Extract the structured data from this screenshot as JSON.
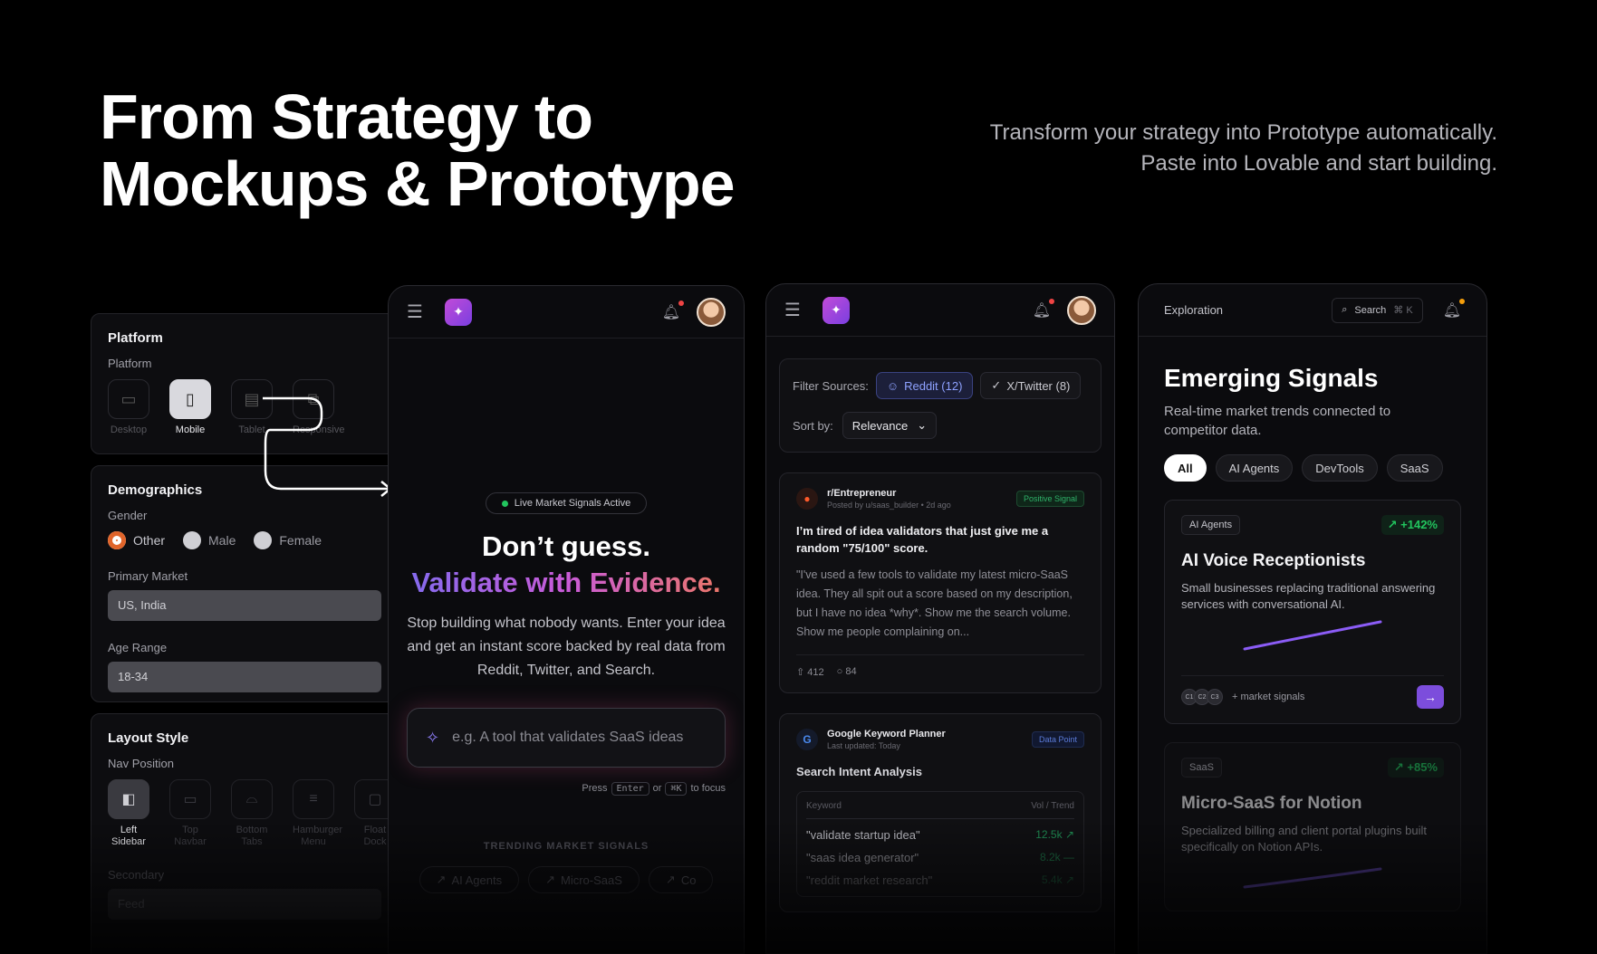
{
  "hero": {
    "title_line1": "From Strategy to",
    "title_line2": "Mockups & Prototype",
    "subtitle_line1": "Transform your strategy into Prototype automatically.",
    "subtitle_line2": "Paste into Lovable and start building."
  },
  "settings": {
    "platform": {
      "title": "Platform",
      "label": "Platform",
      "options": [
        "Desktop",
        "Mobile",
        "Tablet",
        "Responsive"
      ],
      "selected": "Mobile"
    },
    "demographics": {
      "title": "Demographics",
      "gender_label": "Gender",
      "genders": [
        "Other",
        "Male",
        "Female"
      ],
      "selected_gender": "Other",
      "market_label": "Primary Market",
      "market_value": "US, India",
      "age_label": "Age Range",
      "age_value": "18-34"
    },
    "layout": {
      "title": "Layout Style",
      "nav_label": "Nav Position",
      "options": [
        "Left Sidebar",
        "Top Navbar",
        "Bottom Tabs",
        "Hamburger Menu",
        "Float Dock"
      ],
      "selected": "Left Sidebar",
      "secondary_label": "Secondary",
      "secondary_value": "Feed"
    }
  },
  "phone1": {
    "live_label": "Live Market Signals Active",
    "headline1": "Don’t guess.",
    "headline2": "Validate with Evidence.",
    "body": "Stop building what nobody wants. Enter your idea and get an instant score backed by real data from Reddit, Twitter, and Search.",
    "input_placeholder": "e.g. A tool that validates SaaS ideas",
    "hint_press": "Press",
    "hint_key1": "Enter",
    "hint_or": "or",
    "hint_key2": "⌘K",
    "hint_focus": "to focus",
    "trending_title": "TRENDING MARKET SIGNALS",
    "trending": [
      "AI Agents",
      "Micro-SaaS",
      "Co"
    ]
  },
  "phone2": {
    "filter_label": "Filter Sources:",
    "filters": [
      "Reddit (12)",
      "X/Twitter (8)"
    ],
    "sort_label": "Sort by:",
    "sort_value": "Relevance",
    "post": {
      "sub": "r/Entrepreneur",
      "meta": "Posted by u/saas_builder • 2d ago",
      "tag": "Positive Signal",
      "title": "I’m tired of idea validators that just give me a random \"75/100\" score.",
      "body": "\"I've used a few tools to validate my latest micro-SaaS idea. They all spit out a score based on my description, but I have no idea *why*. Show me the search volume. Show me people complaining on...",
      "upvotes": "412",
      "comments": "84"
    },
    "keyword": {
      "source": "Google Keyword Planner",
      "meta": "Last updated: Today",
      "tag": "Data Point",
      "title": "Search Intent Analysis",
      "col1": "Keyword",
      "col2": "Vol / Trend",
      "rows": [
        {
          "kw": "\"validate startup idea\"",
          "vol": "12.5k ↗"
        },
        {
          "kw": "\"saas idea generator\"",
          "vol": "8.2k —"
        },
        {
          "kw": "\"reddit market research\"",
          "vol": "5.4k ↗"
        }
      ]
    }
  },
  "phone3": {
    "section": "Exploration",
    "search_label": "Search",
    "search_key": "⌘ K",
    "title": "Emerging Signals",
    "subtitle": "Real-time market trends connected to competitor data.",
    "chips": [
      "All",
      "AI Agents",
      "DevTools",
      "SaaS"
    ],
    "card1": {
      "tag": "AI Agents",
      "pct": "↗ +142%",
      "title": "AI Voice Receptionists",
      "desc": "Small businesses replacing traditional answering services with conversational AI.",
      "competitors": [
        "C1",
        "C2",
        "C3"
      ],
      "foot": "+ market signals"
    },
    "card2": {
      "tag": "SaaS",
      "pct": "↗ +85%",
      "title": "Micro-SaaS for Notion",
      "desc": "Specialized billing and client portal plugins built specifically on Notion APIs."
    }
  }
}
